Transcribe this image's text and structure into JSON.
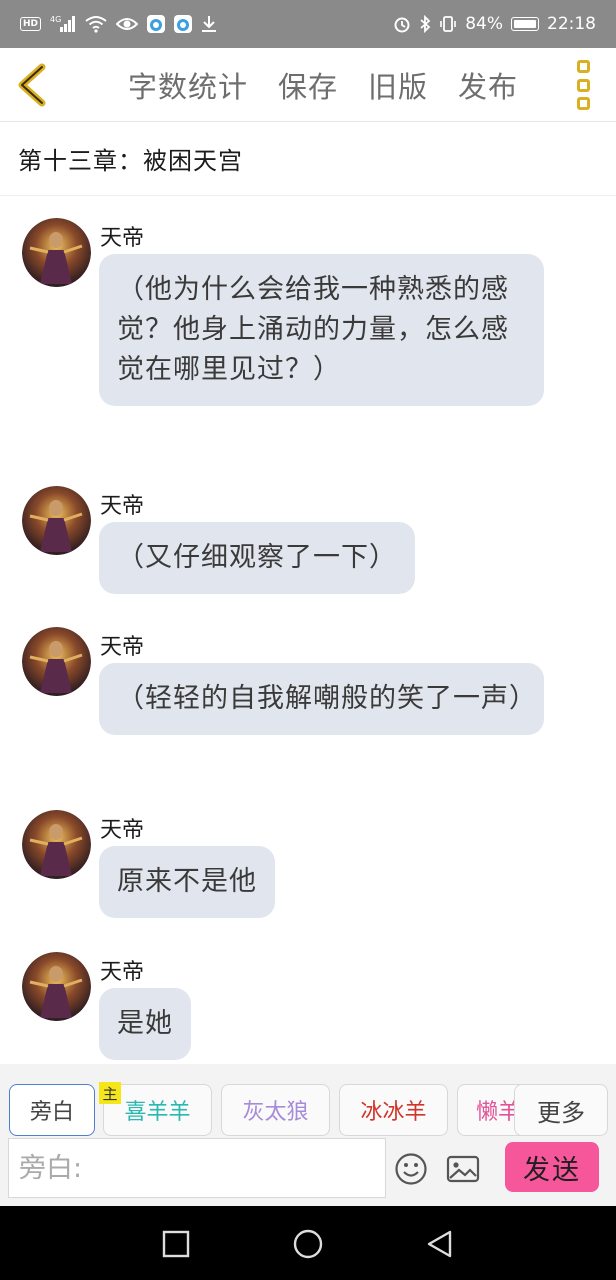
{
  "status_bar": {
    "signal_label": "4G",
    "hd_label": "HD",
    "battery": "84%",
    "time": "22:18",
    "icons": [
      "hd-icon",
      "signal-icon",
      "wifi-icon",
      "eye-icon",
      "app-icon",
      "app-icon",
      "download-icon",
      "alarm-icon",
      "bluetooth-icon",
      "vibrate-icon",
      "battery-icon"
    ]
  },
  "toolbar": {
    "back_icon": "chevron-left-icon",
    "actions": [
      "字数统计",
      "保存",
      "旧版",
      "发布"
    ],
    "more_icon": "more-vertical-icon",
    "accent_color": "#d9b021"
  },
  "chapter": {
    "title": "第十三章：被困天宫"
  },
  "messages": [
    {
      "speaker": "天帝",
      "text": "（他为什么会给我一种熟悉的感觉？他身上涌动的力量，怎么感觉在哪里见过？）"
    },
    {
      "speaker": "天帝",
      "text": "（又仔细观察了一下）"
    },
    {
      "speaker": "天帝",
      "text": "（轻轻的自我解嘲般的笑了一声）"
    },
    {
      "speaker": "天帝",
      "text": "原来不是他"
    },
    {
      "speaker": "天帝",
      "text": "是她"
    }
  ],
  "roles": {
    "items": [
      {
        "label": "旁白",
        "color": "#444444",
        "selected": true
      },
      {
        "label": "喜羊羊",
        "color": "#29b9b0"
      },
      {
        "label": "灰太狼",
        "color": "#a88bd8"
      },
      {
        "label": "冰冰羊",
        "color": "#d0352a"
      },
      {
        "label": "懒羊",
        "color": "#e0559a"
      }
    ],
    "main_tag": "主",
    "more_label": "更多"
  },
  "input": {
    "placeholder": "旁白:",
    "emoji_icon": "emoji-icon",
    "image_icon": "image-icon",
    "send_label": "发送",
    "send_color": "#f6579a"
  },
  "nav": {
    "icons": [
      "recent-apps-icon",
      "home-icon",
      "back-icon"
    ]
  }
}
